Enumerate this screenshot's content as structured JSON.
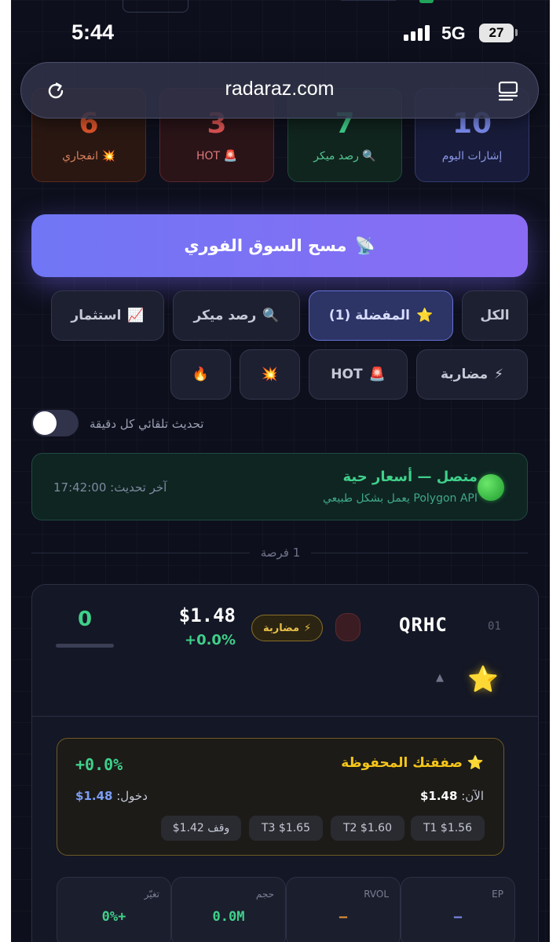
{
  "status_bar": {
    "time": "5:44",
    "network": "5G",
    "battery": "27"
  },
  "browser": {
    "url": "radaraz.com"
  },
  "stats": [
    {
      "value": "6",
      "label": "💥 انفجاري",
      "color": "#e0562c"
    },
    {
      "value": "3",
      "label": "🚨 HOT",
      "color": "#e05555"
    },
    {
      "value": "7",
      "label": "🔍 رصد ميكر",
      "color": "#3fd08a"
    },
    {
      "value": "10",
      "label": "إشارات اليوم",
      "color": "#7c8cf0"
    }
  ],
  "scan_button": {
    "icon": "📡",
    "label": "مسح السوق الفوري"
  },
  "filters": {
    "all": "الكل",
    "favorites": {
      "icon": "⭐",
      "label": "المفضلة (1)"
    },
    "maker": {
      "icon": "🔍",
      "label": "رصد ميكر"
    },
    "invest": {
      "icon": "📈",
      "label": "استثمار"
    },
    "scalp": {
      "icon": "⚡",
      "label": "مضاربة"
    },
    "hot": {
      "icon": "🚨",
      "label": "HOT"
    },
    "explosive": {
      "icon": "💥"
    },
    "fire": {
      "icon": "🔥"
    }
  },
  "auto_refresh": {
    "label": "تحديث تلقائي كل دقيقة",
    "enabled": false
  },
  "connection": {
    "title": "متصل — أسعار حية",
    "subtitle": "Polygon API يعمل بشكل طبيعي",
    "last_update": "آخر تحديث: 17:42:00"
  },
  "results_count": "1 فرصة",
  "result": {
    "index": "01",
    "ticker": "QRHC",
    "tag": {
      "icon": "⚡",
      "label": "مضاربة"
    },
    "price": "$1.48",
    "change": "+0.0%",
    "score": "0",
    "favorite_icon": "⭐",
    "caret": "▲",
    "saved_trade": {
      "title": "⭐ صفقتك المحفوظة",
      "pnl": "+0.0%",
      "now_label": "الآن:",
      "now_value": "1.48$",
      "entry_label": "دخول:",
      "entry_value": "1.48$",
      "targets": [
        "T1 $1.56",
        "T2 $1.60",
        "T3 $1.65",
        "وقف 1.42$"
      ]
    },
    "metrics": [
      {
        "label": "EP",
        "value": "—",
        "color": "#7c8cf0"
      },
      {
        "label": "RVOL",
        "value": "—",
        "color": "#e8913a"
      },
      {
        "label": "حجم",
        "value": "0.0M",
        "color": "#3fd08a"
      },
      {
        "label": "تغيّر",
        "value": "0%+",
        "color": "#3fd08a"
      }
    ]
  }
}
